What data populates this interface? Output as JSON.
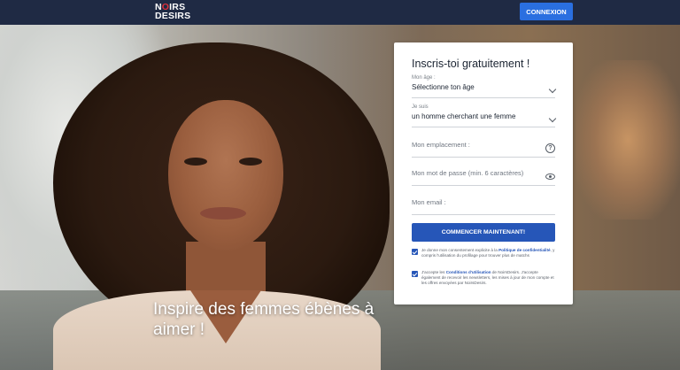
{
  "header": {
    "logo_line1": "NOIRS",
    "logo_line2": "DESIRS",
    "login_button": "CONNEXION"
  },
  "hero": {
    "tagline": "Inspire des femmes ébènes à aimer !"
  },
  "form": {
    "title": "Inscris-toi gratuitement !",
    "age": {
      "label": "Mon âge :",
      "value": "Sélectionne ton âge"
    },
    "je_suis": {
      "label": "Je suis",
      "value": "un homme cherchant une femme"
    },
    "location": {
      "placeholder": "Mon emplacement :"
    },
    "password": {
      "placeholder": "Mon mot de passe (min. 6 caractères)"
    },
    "email": {
      "placeholder": "Mon email :"
    },
    "submit": "COMMENCER MAINTENANT!",
    "consent1": {
      "text_before": "Je donne mon consentement explicite à la ",
      "link": "Politique de confidentialité",
      "text_after": ", y compris l'utilisation du profilage pour trouver plus de matchs"
    },
    "consent2": {
      "text_before": "J'accepte les ",
      "link": "Conditions d'utilisation",
      "text_after": " de NoirsDesirs. J'accepte également de recevoir les newsletters, les mises à jour de mon compte et les offres envoyées par NoirsDesirs."
    }
  },
  "colors": {
    "header_bg": "#1f2a44",
    "accent_blue": "#2656b8",
    "login_blue": "#2a6fe0",
    "logo_red": "#e0303b"
  },
  "icons": {
    "select": "chevron-down-icon",
    "help": "question-icon",
    "password": "eye-icon",
    "checkbox": "checkbox-checked-icon"
  }
}
